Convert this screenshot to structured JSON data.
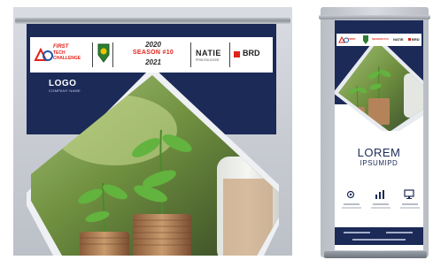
{
  "banner_left": {
    "sponsors": {
      "ftc_line1": "FIRST",
      "ftc_line2": "TECH",
      "ftc_line3": "CHALLENGE",
      "season_line1": "2020",
      "season_line2": "SEASON #10",
      "season_line3": "2021",
      "natie_main": "NATIE",
      "natie_sub": "PRIN EDUCATIE",
      "brd": "BRD"
    },
    "logo_text": "LOGO",
    "logo_sub": "COMPANY NAME"
  },
  "banner_right": {
    "title": "LOREM",
    "subtitle": "IPSUMIPD"
  },
  "colors": {
    "navy": "#1b2a57",
    "brand_red": "#e2231a",
    "plant_green": "#5aa23c",
    "coin_bronze": "#b5835a"
  }
}
